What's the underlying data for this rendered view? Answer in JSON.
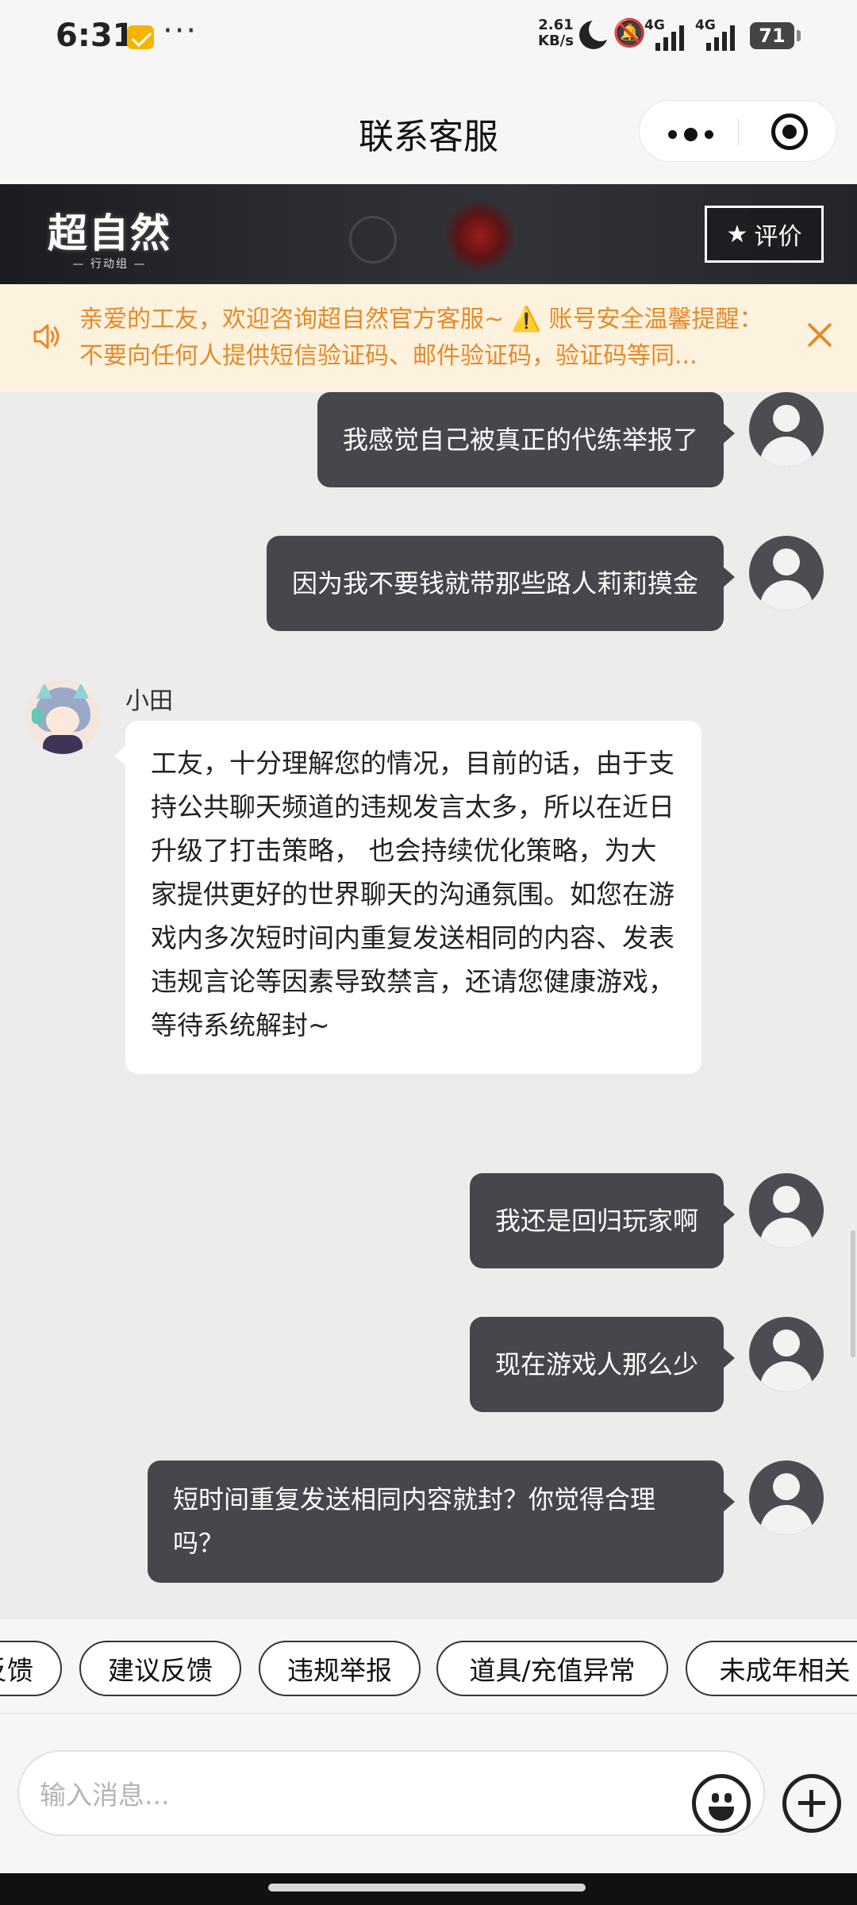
{
  "status_bar": {
    "time": "6:31",
    "more": "···",
    "speed_value": "2.61",
    "speed_unit": "KB/s",
    "net1": "4G",
    "net2": "4G",
    "battery": "71"
  },
  "nav": {
    "title": "联系客服"
  },
  "banner": {
    "logo_main": "超自然",
    "logo_sub": "— 行动组 —",
    "rate_label": "评价"
  },
  "notice": {
    "text": "亲爱的工友，欢迎咨询超自然官方客服~ ⚠️ 账号安全温馨提醒： 不要向任何人提供短信验证码、邮件验证码，验证码等同..."
  },
  "chat": {
    "messages": [
      {
        "from": "user",
        "text": "我感觉自己被真正的代练举报了"
      },
      {
        "from": "user",
        "text": "因为我不要钱就带那些路人莉莉摸金"
      },
      {
        "from": "agent",
        "name": "小田",
        "text": "工友，十分理解您的情况，目前的话，由于支持公共聊天频道的违规发言太多，所以在近日升级了打击策略， 也会持续优化策略，为大家提供更好的世界聊天的沟通氛围。如您在游戏内多次短时间内重复发送相同的内容、发表违规言论等因素导致禁言，还请您健康游戏，等待系统解封~"
      },
      {
        "from": "user",
        "text": "我还是回归玩家啊"
      },
      {
        "from": "user",
        "text": "现在游戏人那么少"
      },
      {
        "from": "user",
        "text": "短时间重复发送相同内容就封？你觉得合理吗？"
      }
    ]
  },
  "quick_replies": [
    "反馈",
    "建议反馈",
    "违规举报",
    "道具/充值异常",
    "未成年相关"
  ],
  "input": {
    "placeholder": "输入消息...",
    "value": ""
  },
  "colors": {
    "user_bubble": "#46474d",
    "notice_text": "#e7892a",
    "notice_bg": "#fcf2dd"
  }
}
